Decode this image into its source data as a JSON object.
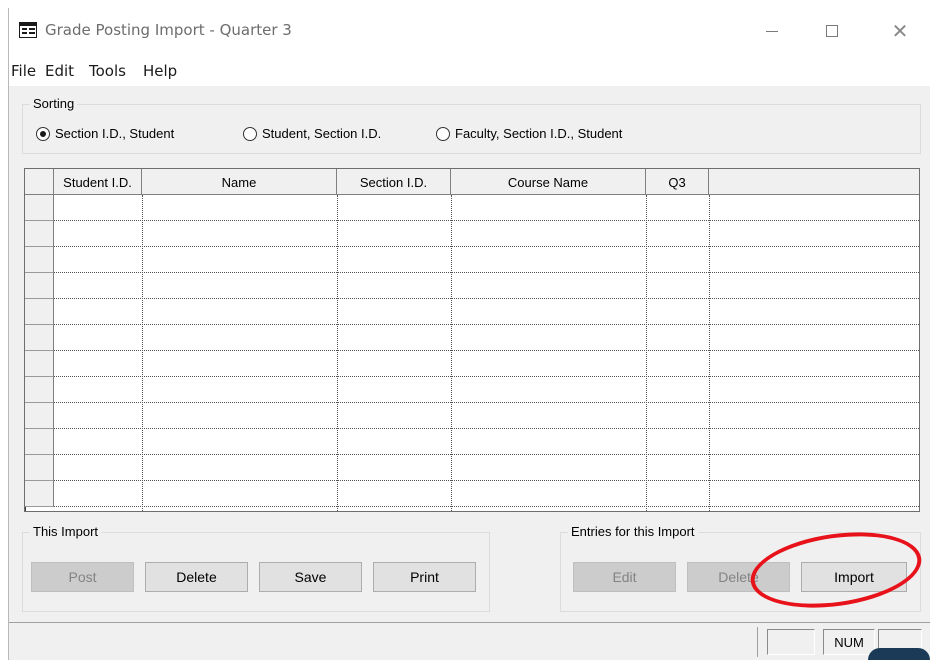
{
  "window": {
    "title": "Grade Posting Import - Quarter 3",
    "controls": {
      "minimize": "—",
      "maximize": "☐",
      "close": "✕"
    }
  },
  "menu": [
    "File",
    "Edit",
    "Tools",
    "Help"
  ],
  "sorting": {
    "title": "Sorting",
    "options": [
      {
        "label": "Section I.D., Student",
        "selected": true
      },
      {
        "label": "Student, Section I.D.",
        "selected": false
      },
      {
        "label": "Faculty, Section I.D., Student",
        "selected": false
      }
    ]
  },
  "table": {
    "columns": [
      "Student I.D.",
      "Name",
      "Section I.D.",
      "Course Name",
      "Q3",
      ""
    ],
    "row_count": 12
  },
  "this_import": {
    "title": "This Import",
    "buttons": [
      {
        "label": "Post",
        "enabled": false
      },
      {
        "label": "Delete",
        "enabled": true
      },
      {
        "label": "Save",
        "enabled": true
      },
      {
        "label": "Print",
        "enabled": true
      }
    ]
  },
  "entries": {
    "title": "Entries for this Import",
    "buttons": [
      {
        "label": "Edit",
        "enabled": false
      },
      {
        "label": "Delete",
        "enabled": false
      },
      {
        "label": "Import",
        "enabled": true
      }
    ]
  },
  "status": {
    "panels": [
      "",
      "NUM",
      ""
    ]
  },
  "colors": {
    "annotation": "#e8121a",
    "window_bg": "#f0f0f0"
  }
}
